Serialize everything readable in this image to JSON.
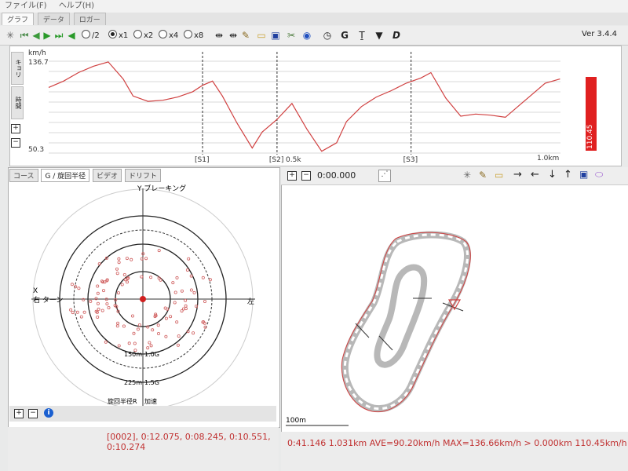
{
  "menu": [
    "ファイル(F)",
    "ヘルプ(H)"
  ],
  "main_tabs": [
    "グラフ",
    "データ",
    "ロガー"
  ],
  "toolbar": {
    "speeds": [
      "/2",
      "x1",
      "x2",
      "x4",
      "x8"
    ],
    "selected_speed": "x1",
    "letter_g": "G",
    "letter_d": "D"
  },
  "version": "Ver 3.4.4",
  "speed_chart": {
    "unit": "km/h",
    "y_max_label": "136.7",
    "y_min_label": "50.3",
    "x_label_mid": "0.5k",
    "x_label_end": "1.0km",
    "sectors": [
      "[S1]",
      "[S2]",
      "[S3]"
    ],
    "vtabs": [
      "キョリ",
      "時間"
    ]
  },
  "chart_data": {
    "type": "line",
    "xlabel": "",
    "ylabel": "km/h",
    "xlim": [
      0,
      1.031
    ],
    "ylim": [
      50.3,
      136.7
    ],
    "x": [
      0.0,
      0.03,
      0.06,
      0.09,
      0.12,
      0.15,
      0.17,
      0.2,
      0.23,
      0.26,
      0.29,
      0.31,
      0.33,
      0.35,
      0.38,
      0.41,
      0.43,
      0.46,
      0.49,
      0.52,
      0.55,
      0.58,
      0.6,
      0.63,
      0.66,
      0.69,
      0.72,
      0.75,
      0.77,
      0.8,
      0.83,
      0.86,
      0.89,
      0.92,
      0.95,
      0.98,
      1.0,
      1.03
    ],
    "series": [
      {
        "values": [
          112,
          118,
          126,
          132,
          136,
          120,
          104,
          99,
          100,
          103,
          108,
          114,
          118,
          104,
          78,
          55,
          70,
          82,
          97,
          73,
          52,
          60,
          80,
          94,
          103,
          109,
          116,
          121,
          126,
          102,
          85,
          87,
          86,
          84,
          96,
          108,
          116,
          120
        ]
      }
    ],
    "sector_x": [
      0.31,
      0.46,
      0.73
    ],
    "red_bar": {
      "value": 110.45,
      "max": 136.7
    }
  },
  "current_speed": "110.45",
  "left_tabs": [
    "コース",
    "G / 旋回半径",
    "ビデオ",
    "ドリフト"
  ],
  "gg": {
    "y_label": "Y ブレーキング",
    "x_label": "X",
    "right_turn": "右\nターン",
    "left": "左",
    "r150": "150m",
    "g10": "1.0G",
    "r225": "225m",
    "g15": "1.5G",
    "bottom_left": "旋回半径R",
    "bottom_right": "加速"
  },
  "left_status": "[0002], 0:12.075, 0:08.245, 0:10.551, 0:10.274",
  "right_toolbar": {
    "time": "0:00.000"
  },
  "map": {
    "scale": "100m"
  },
  "right_status": "0:41.146 1.031km AVE=90.20km/h MAX=136.66km/h > 0.000km 110.45km/h",
  "colors": {
    "line": "#d04040",
    "bar": "#e02020",
    "status": "#c03030"
  }
}
